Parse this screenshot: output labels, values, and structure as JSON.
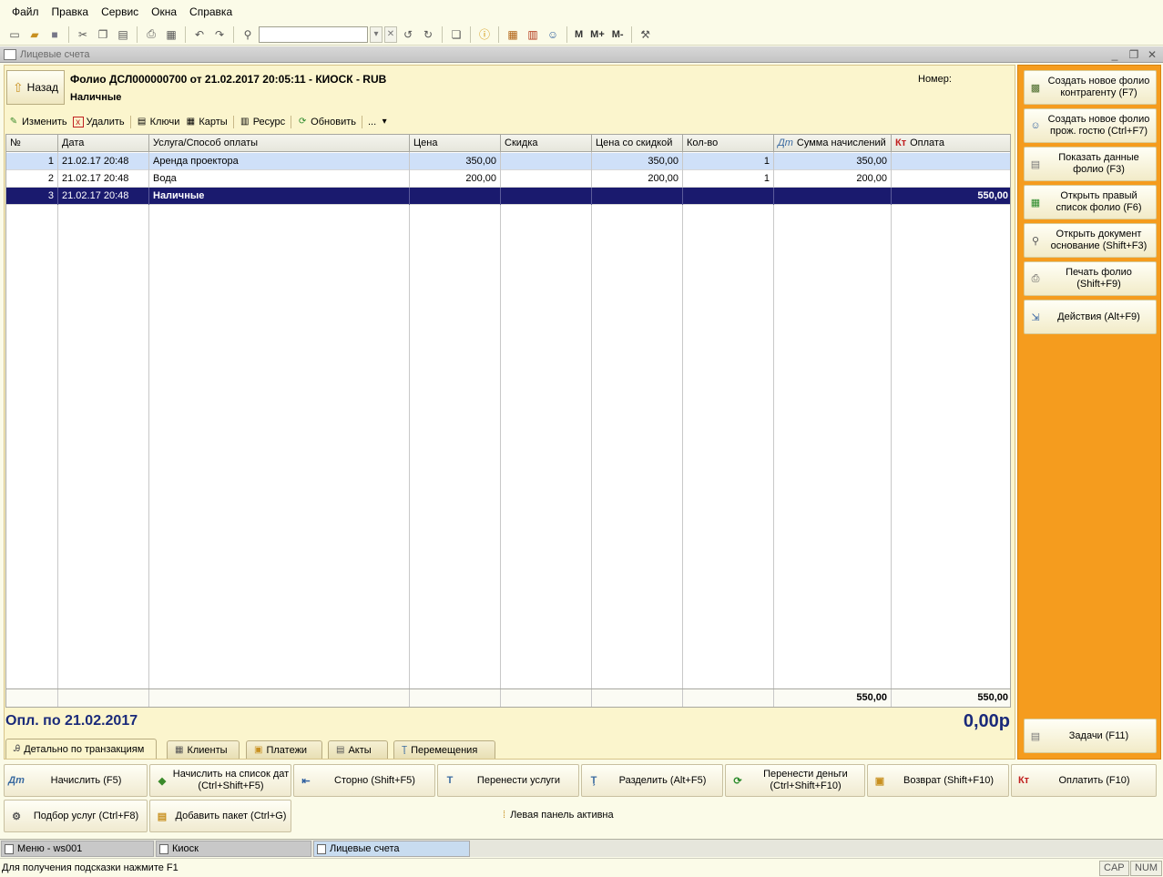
{
  "menu": [
    "Файл",
    "Правка",
    "Сервис",
    "Окна",
    "Справка"
  ],
  "toolbar": {
    "buttons": [
      "new-doc-icon",
      "open-icon",
      "save-icon",
      "cut-icon",
      "copy-icon",
      "paste-icon",
      "print-icon",
      "print-preview-icon",
      "undo-icon",
      "redo-icon",
      "find-icon"
    ],
    "search_value": "",
    "memory_labels": [
      "M",
      "M+",
      "M-"
    ]
  },
  "window": {
    "title": "Лицевые счета"
  },
  "header": {
    "back_label": "Назад",
    "folio_title": "Фолио ДСЛ000000700 от 21.02.2017 20:05:11 - КИОСК - RUB",
    "payment_type": "Наличные",
    "nomer_label": "Номер:"
  },
  "subtoolbar": [
    {
      "label": "Изменить",
      "icon": "edit-icon"
    },
    {
      "label": "Удалить",
      "icon": "delete-icon"
    },
    {
      "label": "Ключи",
      "icon": "keys-icon"
    },
    {
      "label": "Карты",
      "icon": "cards-icon"
    },
    {
      "label": "Ресурс",
      "icon": "resource-icon"
    },
    {
      "label": "Обновить",
      "icon": "refresh-icon"
    },
    {
      "label": "...",
      "icon": "more-icon"
    }
  ],
  "grid": {
    "columns": [
      "№",
      "Дата",
      "Услуга/Способ оплаты",
      "Цена",
      "Скидка",
      "Цена со скидкой",
      "Кол-во",
      "Сумма начислений",
      "Оплата"
    ],
    "column_prefix": {
      "sum": "Дт",
      "pay": "Кт"
    },
    "rows": [
      {
        "n": "1",
        "date": "21.02.17 20:48",
        "service": "Аренда проектора",
        "price": "350,00",
        "discount": "",
        "dprice": "350,00",
        "qty": "1",
        "sum": "350,00",
        "pay": ""
      },
      {
        "n": "2",
        "date": "21.02.17 20:48",
        "service": "Вода",
        "price": "200,00",
        "discount": "",
        "dprice": "200,00",
        "qty": "1",
        "sum": "200,00",
        "pay": ""
      },
      {
        "n": "3",
        "date": "21.02.17 20:48",
        "service": "Наличные",
        "price": "",
        "discount": "",
        "dprice": "",
        "qty": "",
        "sum": "",
        "pay": "550,00"
      }
    ],
    "totals": {
      "sum": "550,00",
      "pay": "550,00"
    }
  },
  "summary": {
    "label": "Опл. по 21.02.2017",
    "balance": "0,00р"
  },
  "tabs": [
    {
      "label": "Детально по транзакциям",
      "icon": "detail-icon"
    },
    {
      "label": "Клиенты",
      "icon": "clients-icon"
    },
    {
      "label": "Платежи",
      "icon": "payments-icon"
    },
    {
      "label": "Акты",
      "icon": "acts-icon"
    },
    {
      "label": "Перемещения",
      "icon": "move-icon"
    }
  ],
  "right_buttons": [
    {
      "label": "Создать новое фолио контрагенту (F7)",
      "icon": "new-folio-contractor-icon"
    },
    {
      "label": "Создать новое фолио прож. гостю (Ctrl+F7)",
      "icon": "new-folio-guest-icon"
    },
    {
      "label": "Показать данные фолио (F3)",
      "icon": "folio-data-icon"
    },
    {
      "label": "Открыть правый список фолио (F6)",
      "icon": "folio-list-icon"
    },
    {
      "label": "Открыть документ основание (Shift+F3)",
      "icon": "open-doc-icon"
    },
    {
      "label": "Печать фолио (Shift+F9)",
      "icon": "print-icon"
    },
    {
      "label": "Действия (Alt+F9)",
      "icon": "actions-icon"
    }
  ],
  "tasks_button": {
    "label": "Задачи (F11)",
    "icon": "tasks-icon"
  },
  "bottom_row1": [
    {
      "label": "Начислить (F5)",
      "icon": "Дт"
    },
    {
      "label": "Начислить на список дат (Ctrl+Shift+F5)",
      "icon": "◆"
    },
    {
      "label": "Сторно (Shift+F5)",
      "icon": "⇤"
    },
    {
      "label": "Перенести услуги",
      "icon": "T"
    },
    {
      "label": "Разделить (Alt+F5)",
      "icon": "Ţ"
    },
    {
      "label": "Перенести деньги (Ctrl+Shift+F10)",
      "icon": "⟳"
    },
    {
      "label": "Возврат (Shift+F10)",
      "icon": "▣"
    },
    {
      "label": "Оплатить (F10)",
      "icon": "Кт"
    }
  ],
  "bottom_row2": [
    {
      "label": "Подбор услуг (Ctrl+F8)",
      "icon": "⚙"
    },
    {
      "label": "Добавить пакет (Ctrl+G)",
      "icon": "▤"
    }
  ],
  "panel_status": "Левая панель активна",
  "taskbar": [
    {
      "label": "Меню - ws001"
    },
    {
      "label": "Киоск"
    },
    {
      "label": "Лицевые счета"
    }
  ],
  "status": {
    "hint": "Для получения подсказки нажмите F1",
    "cap": "CAP",
    "num": "NUM"
  }
}
